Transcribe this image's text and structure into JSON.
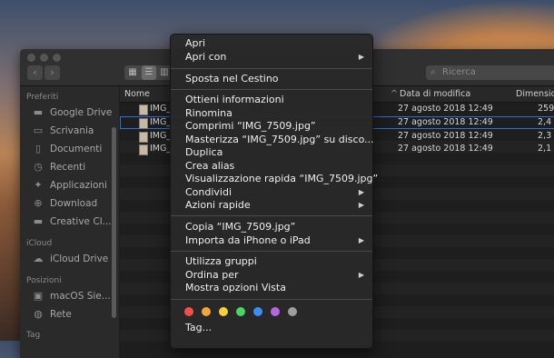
{
  "toolbar": {
    "back_icon": "‹",
    "forward_icon": "›",
    "view_icons": [
      "▦",
      "☰",
      "▥"
    ],
    "search_placeholder": "Ricerca",
    "search_icon": "⌕"
  },
  "sidebar": {
    "sections": [
      {
        "title": "Preferiti",
        "items": [
          {
            "label": "Google Drive",
            "icon": "▬"
          },
          {
            "label": "Scrivania",
            "icon": "▭"
          },
          {
            "label": "Documenti",
            "icon": "▯"
          },
          {
            "label": "Recenti",
            "icon": "◷"
          },
          {
            "label": "Applicazioni",
            "icon": "✦"
          },
          {
            "label": "Download",
            "icon": "⊕"
          },
          {
            "label": "Creative Cl...",
            "icon": "▬"
          }
        ]
      },
      {
        "title": "iCloud",
        "items": [
          {
            "label": "iCloud Drive",
            "icon": "☁"
          }
        ]
      },
      {
        "title": "Posizioni",
        "items": [
          {
            "label": "macOS Sie...",
            "icon": "▣"
          },
          {
            "label": "Rete",
            "icon": "◍"
          }
        ]
      },
      {
        "title": "Tag",
        "items": []
      }
    ]
  },
  "file_list": {
    "columns": {
      "name": "Nome",
      "date": "Data di modifica",
      "size": "Dimensione"
    },
    "rows": [
      {
        "name": "IMG_",
        "date": "27 agosto 2018 12:49",
        "size": "259"
      },
      {
        "name": "IMG_",
        "date": "27 agosto 2018 12:49",
        "size": "2,4"
      },
      {
        "name": "IMG_",
        "date": "27 agosto 2018 12:49",
        "size": "2,3"
      },
      {
        "name": "IMG_",
        "date": "27 agosto 2018 12:49",
        "size": "2,1"
      }
    ]
  },
  "context_menu": {
    "groups": [
      [
        {
          "label": "Apri"
        },
        {
          "label": "Apri con",
          "submenu": true
        }
      ],
      [
        {
          "label": "Sposta nel Cestino"
        }
      ],
      [
        {
          "label": "Ottieni informazioni"
        },
        {
          "label": "Rinomina"
        },
        {
          "label": "Comprimi “IMG_7509.jpg”"
        },
        {
          "label": "Masterizza “IMG_7509.jpg” su disco..."
        },
        {
          "label": "Duplica"
        },
        {
          "label": "Crea alias"
        },
        {
          "label": "Visualizzazione rapida “IMG_7509.jpg”"
        },
        {
          "label": "Condividi",
          "submenu": true
        },
        {
          "label": "Azioni rapide",
          "submenu": true
        }
      ],
      [
        {
          "label": "Copia “IMG_7509.jpg”"
        },
        {
          "label": "Importa da iPhone o iPad",
          "submenu": true
        }
      ],
      [
        {
          "label": "Utilizza gruppi"
        },
        {
          "label": "Ordina per",
          "submenu": true
        },
        {
          "label": "Mostra opzioni Vista"
        }
      ]
    ],
    "tag_colors": [
      "#f0504a",
      "#f3a43c",
      "#f3d13c",
      "#4cd364",
      "#3a8ef6",
      "#b767dd",
      "#9e9e9e"
    ],
    "tags_label": "Tag..."
  }
}
